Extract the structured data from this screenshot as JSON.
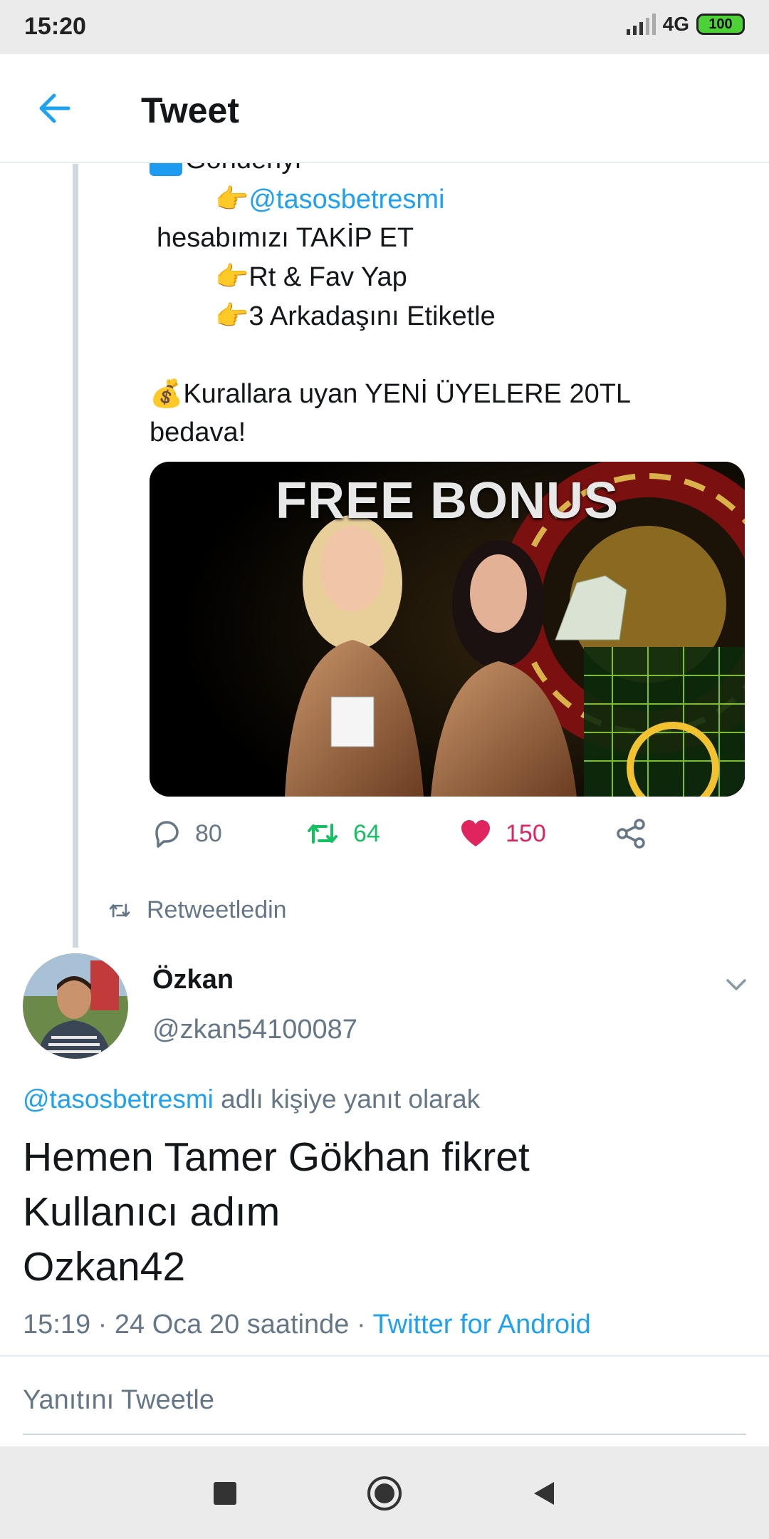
{
  "status_bar": {
    "time": "15:20",
    "network": "4G",
    "battery": "100"
  },
  "header": {
    "title": "Tweet",
    "back_icon": "arrow-left-icon"
  },
  "tweet": {
    "cut_line": "Gönderiyi",
    "line1_emoji": "👉",
    "line1_mention": "@tasosbetresmi",
    "line2": "hesabımızı TAKİP ET",
    "line3_emoji": "👉",
    "line3": "Rt & Fav Yap",
    "line4_emoji": "👉",
    "line4": "3 Arkadaşını Etiketle",
    "line5_emoji": "💰",
    "line5": "Kurallara uyan YENİ ÜYELERE 20TL",
    "line6": "bedava!",
    "media_title": "FREE BONUS",
    "replies": "80",
    "retweets": "64",
    "likes": "150"
  },
  "retweet_label": "Retweetledin",
  "reply_tweet": {
    "display_name": "Özkan",
    "handle": "@zkan54100087",
    "reply_to_mention": "@tasosbetresmi",
    "reply_to_text": " adlı kişiye yanıt olarak",
    "body_line1": "Hemen Tamer Gökhan fikret",
    "body_line2": "Kullanıcı adım",
    "body_line3": "Ozkan42",
    "meta_time": "15:19 · 24 Oca 20 saatinde · ",
    "meta_client": "Twitter for Android"
  },
  "reply_box_placeholder": "Yanıtını Tweetle",
  "colors": {
    "accent": "#1da1f2",
    "like": "#e0245e",
    "retweet": "#17bf63",
    "secondary": "#657786"
  }
}
